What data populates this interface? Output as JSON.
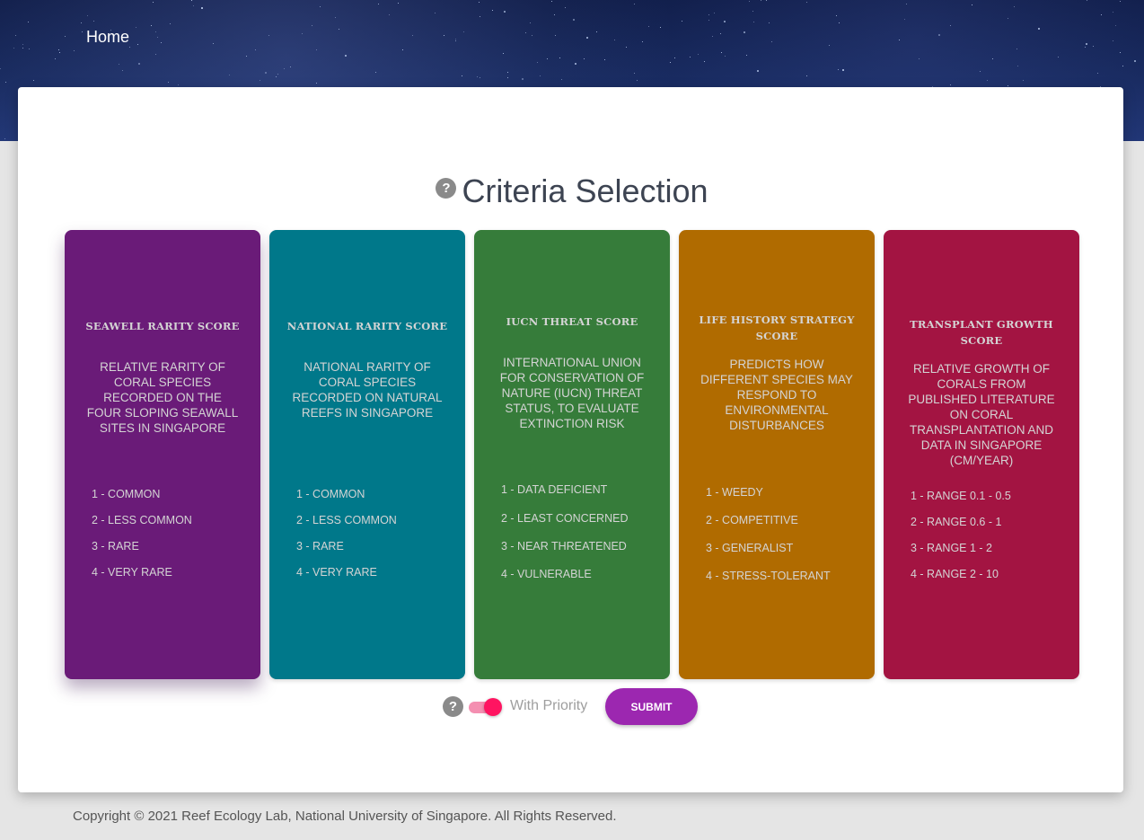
{
  "nav": {
    "home_label": "Home"
  },
  "page": {
    "title": "Criteria Selection",
    "help_glyph": "?"
  },
  "criteria": [
    {
      "title": "SEAWELL RARITY SCORE",
      "description": "RELATIVE RARITY OF CORAL SPECIES RECORDED ON THE FOUR SLOPING SEAWALL SITES IN SINGAPORE",
      "options": [
        "1 - COMMON",
        "2 - LESS COMMON",
        "3 - RARE",
        "4 - VERY RARE"
      ],
      "color": "#6a1b78",
      "selected": true
    },
    {
      "title": "NATIONAL RARITY SCORE",
      "description": "NATIONAL RARITY OF CORAL SPECIES RECORDED ON NATURAL REEFS IN SINGAPORE",
      "options": [
        "1 - COMMON",
        "2 - LESS COMMON",
        "3 - RARE",
        "4 - VERY RARE"
      ],
      "color": "#00788a",
      "selected": false
    },
    {
      "title": "IUCN THREAT SCORE",
      "description": "INTERNATIONAL UNION FOR CONSERVATION OF NATURE (IUCN) THREAT STATUS, TO EVALUATE EXTINCTION RISK",
      "options": [
        "1 - DATA DEFICIENT",
        "2 - LEAST CONCERNED",
        "3 - NEAR THREATENED",
        "4 - VULNERABLE"
      ],
      "color": "#367c3a",
      "selected": false
    },
    {
      "title": "LIFE HISTORY STRATEGY SCORE",
      "description": "PREDICTS HOW DIFFERENT SPECIES MAY RESPOND TO ENVIRONMENTAL DISTURBANCES",
      "options": [
        "1 - WEEDY",
        "2 - COMPETITIVE",
        "3 - GENERALIST",
        "4 - STRESS-TOLERANT"
      ],
      "color": "#b06b00",
      "selected": false
    },
    {
      "title": "TRANSPLANT GROWTH SCORE",
      "description": "RELATIVE GROWTH OF CORALS FROM PUBLISHED LITERATURE ON CORAL TRANSPLANTATION AND DATA IN SINGAPORE (CM/YEAR)",
      "options": [
        "1 - RANGE 0.1 - 0.5",
        "2 - RANGE 0.6 - 1",
        "3 - RANGE 1 - 2",
        "4 - RANGE 2 - 10"
      ],
      "color": "#a31442",
      "selected": false
    }
  ],
  "controls": {
    "priority_label": "With Priority",
    "priority_enabled": true,
    "submit_label": "SUBMIT",
    "accent": "#9c27b0",
    "toggle_color": "#ff1461"
  },
  "footer": {
    "copyright": "Copyright © 2021 Reef Ecology Lab, National University of Singapore. All Rights Reserved."
  }
}
